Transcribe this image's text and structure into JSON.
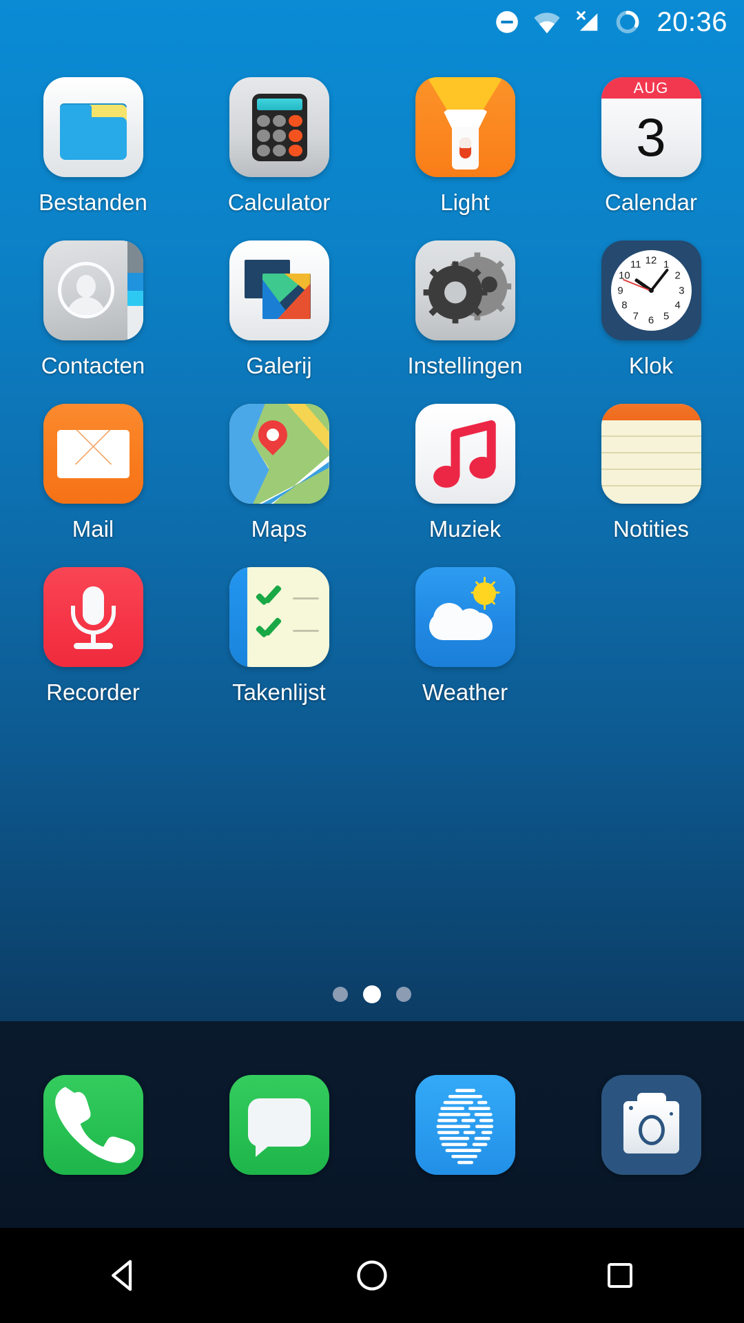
{
  "status_bar": {
    "icons": [
      {
        "name": "do-not-disturb-icon",
        "glyph": "dnd"
      },
      {
        "name": "wifi-icon",
        "glyph": "wifi"
      },
      {
        "name": "cellular-signal-off-icon",
        "glyph": "signal-x"
      },
      {
        "name": "sync-icon",
        "glyph": "ring"
      }
    ],
    "time": "20:36"
  },
  "home_screen": {
    "apps": [
      {
        "label": "Bestanden",
        "icon": "files-icon"
      },
      {
        "label": "Calculator",
        "icon": "calculator-icon"
      },
      {
        "label": "Light",
        "icon": "flashlight-icon"
      },
      {
        "label": "Calendar",
        "icon": "calendar-icon",
        "month": "AUG",
        "day": "3"
      },
      {
        "label": "Contacten",
        "icon": "contacts-icon"
      },
      {
        "label": "Galerij",
        "icon": "gallery-icon"
      },
      {
        "label": "Instellingen",
        "icon": "settings-gears-icon"
      },
      {
        "label": "Klok",
        "icon": "clock-icon"
      },
      {
        "label": "Mail",
        "icon": "mail-envelope-icon"
      },
      {
        "label": "Maps",
        "icon": "maps-pin-icon"
      },
      {
        "label": "Muziek",
        "icon": "music-note-icon"
      },
      {
        "label": "Notities",
        "icon": "notes-icon"
      },
      {
        "label": "Recorder",
        "icon": "microphone-icon"
      },
      {
        "label": "Takenlijst",
        "icon": "checklist-icon"
      },
      {
        "label": "Weather",
        "icon": "weather-sun-cloud-icon"
      }
    ],
    "clock_numbers": [
      "12",
      "1",
      "2",
      "3",
      "4",
      "5",
      "6",
      "7",
      "8",
      "9",
      "10",
      "11"
    ]
  },
  "page_indicator": {
    "count": 3,
    "active_index": 1
  },
  "dock": {
    "items": [
      {
        "name": "phone-app",
        "icon": "phone-icon"
      },
      {
        "name": "messages-app",
        "icon": "message-bubble-icon"
      },
      {
        "name": "browser-app",
        "icon": "browser-globe-icon"
      },
      {
        "name": "camera-app",
        "icon": "camera-icon"
      }
    ]
  },
  "nav_bar": {
    "buttons": [
      {
        "name": "back-button",
        "icon": "triangle-back-icon"
      },
      {
        "name": "home-button",
        "icon": "circle-home-icon"
      },
      {
        "name": "recents-button",
        "icon": "square-recents-icon"
      }
    ]
  },
  "colors": {
    "wallpaper_top": "#0a8bd4",
    "wallpaper_bottom": "#071a2e",
    "dock_bg": "#0a1a2d",
    "nav_bg": "#000000",
    "label_text": "#ffffff",
    "accent_red": "#f2384f",
    "accent_green": "#27c052",
    "accent_orange": "#f97d1f"
  }
}
